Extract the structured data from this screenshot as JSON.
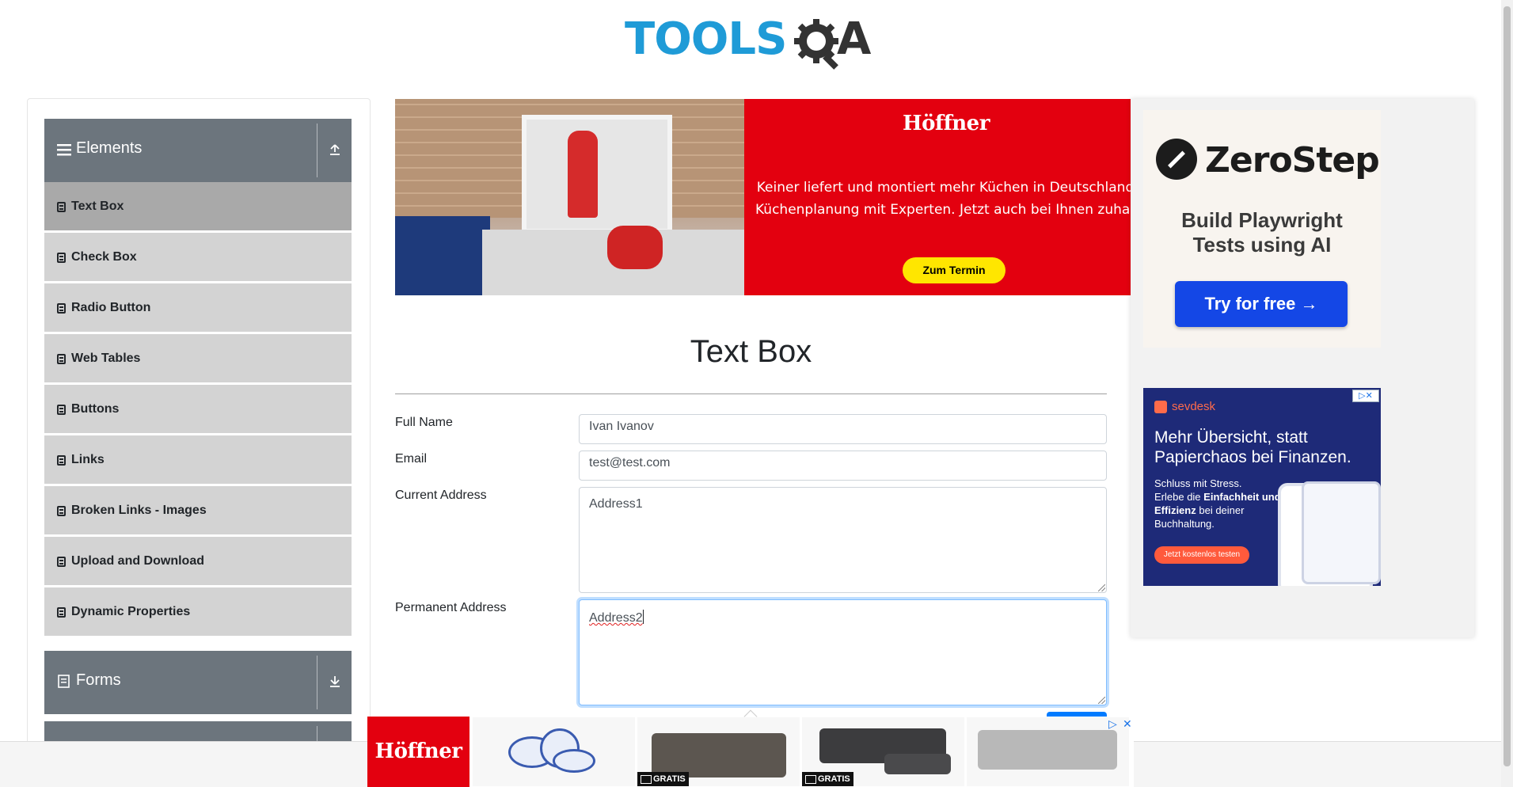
{
  "header": {
    "logo_text": "TOOLS",
    "logo_suffix": "A"
  },
  "sidebar": {
    "groups": [
      {
        "label": "Elements",
        "expanded": true
      },
      {
        "label": "Forms",
        "expanded": false
      }
    ],
    "items": [
      {
        "label": "Text Box",
        "active": true
      },
      {
        "label": "Check Box"
      },
      {
        "label": "Radio Button"
      },
      {
        "label": "Web Tables"
      },
      {
        "label": "Buttons"
      },
      {
        "label": "Links"
      },
      {
        "label": "Broken Links - Images"
      },
      {
        "label": "Upload and Download"
      },
      {
        "label": "Dynamic Properties"
      }
    ]
  },
  "banner_ad": {
    "brand": "Höffner",
    "line1": "Keiner liefert und montiert mehr Küchen in Deutschland",
    "line2": "Küchenplanung mit Experten. Jetzt auch bei Ihnen zuhause",
    "cta": "Zum Termin"
  },
  "side_ads": {
    "zerostep": {
      "brand": "ZeroStep",
      "tagline_1": "Build Playwright",
      "tagline_2": "Tests using AI",
      "cta": "Try for free →"
    },
    "sevdesk": {
      "brand": "sevdesk",
      "headline": "Mehr Übersicht, statt Papierchaos bei Finanzen.",
      "sub_1": "Schluss mit Stress.",
      "sub_2": "Erlebe die",
      "sub_bold": "Einfachheit und Effizienz",
      "sub_3": "bei deiner Buchhaltung.",
      "cta": "Jetzt kostenlos testen"
    }
  },
  "main": {
    "title": "Text Box",
    "fields": {
      "full_name_label": "Full Name",
      "full_name_value": "Ivan Ivanov",
      "email_label": "Email",
      "email_value": "test@test.com",
      "current_address_label": "Current Address",
      "current_address_value": "Address1",
      "permanent_address_label": "Permanent Address",
      "permanent_address_value": "Address2"
    }
  },
  "bottom_ad": {
    "brand": "Höffner",
    "badge": "GRATIS",
    "close": "✕",
    "choice": "▷"
  },
  "colors": {
    "sidebar_group": "#6c757d",
    "menu_item": "#d3d3d3",
    "menu_item_active": "#a9a9a9",
    "logo_blue": "#1f9bd7",
    "hoffner_red": "#e3000f",
    "zerostep_cta": "#1447e6",
    "sevdesk_bg": "#1e2a78"
  }
}
